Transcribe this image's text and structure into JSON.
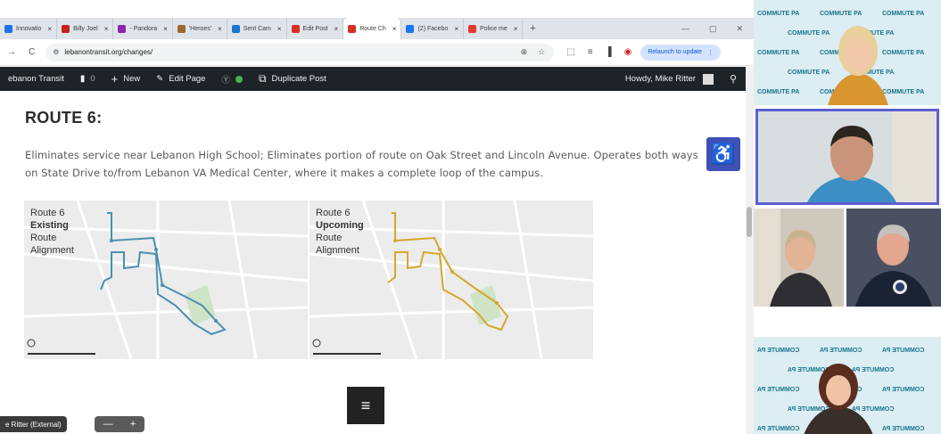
{
  "browser": {
    "tabs": [
      {
        "label": "Innovatio",
        "color": "#1a73e8"
      },
      {
        "label": "Billy Joel",
        "color": "#c5221f"
      },
      {
        "label": "- Pandora",
        "color": "#8e24aa"
      },
      {
        "label": "'Heroes' ",
        "color": "#9e6a2a"
      },
      {
        "label": "Sent Cam",
        "color": "#1976d2"
      },
      {
        "label": "Edit Post",
        "color": "#d93025"
      },
      {
        "label": "Route Ch",
        "color": "#d93025",
        "active": true
      },
      {
        "label": "(2) Facebo",
        "color": "#1877f2"
      },
      {
        "label": "Police me",
        "color": "#e53935"
      }
    ],
    "tab_close": "×",
    "new_tab": "+",
    "window_controls": [
      "—",
      "▢",
      "✕"
    ],
    "back": "→",
    "reload": "C",
    "site_info": "⚙",
    "url": "lebanontransit.org/changes/",
    "relaunch_label": "Relaunch to update",
    "more": "⋮"
  },
  "wp_admin_bar": {
    "site_name": "ebanon Transit",
    "comments_count": "0",
    "new_label": "New",
    "edit_page_label": "Edit Page",
    "duplicate_label": "Duplicate Post",
    "howdy": "Howdy, Mike Ritter"
  },
  "page": {
    "title": "ROUTE 6:",
    "description": "Eliminates service near Lebanon High School; Eliminates portion of route on Oak Street and Lincoln Avenue. Operates both ways on State Drive to/from Lebanon VA Medical Center, where it makes a complete loop of the campus.",
    "maps": [
      {
        "line1": "Route 6",
        "line2": "Existing",
        "line3": "Route",
        "line4": "Alignment",
        "route_color": "#4a8fb0"
      },
      {
        "line1": "Route 6",
        "line2": "Upcoming",
        "line3": "Route",
        "line4": "Alignment",
        "route_color": "#d4a72c"
      }
    ],
    "menu_icon": "≡",
    "accessibility_icon": "♿"
  },
  "meeting": {
    "presenter_tag": "e Ritter (External)",
    "zoom_minus": "—",
    "zoom_plus": "+",
    "logo_text": "COMMUTE PA"
  }
}
